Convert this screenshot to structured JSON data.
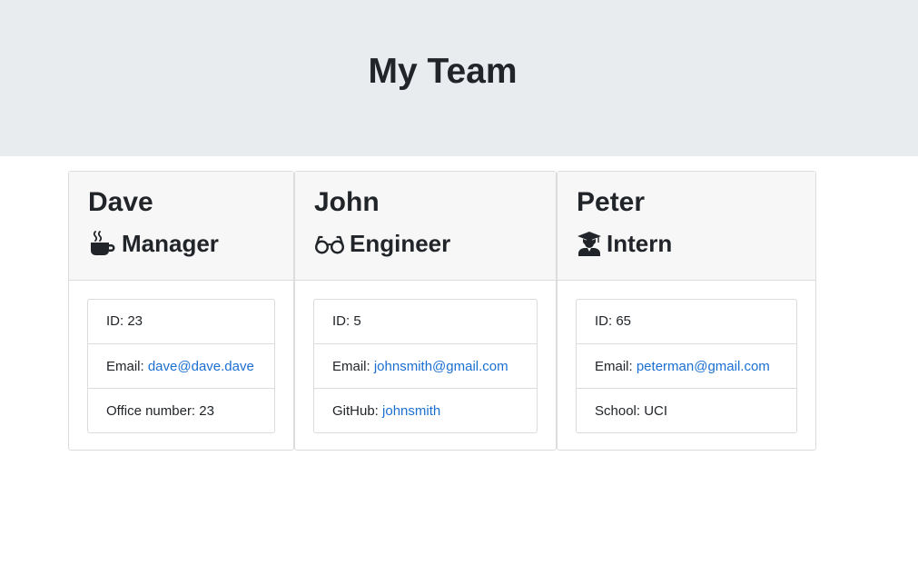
{
  "header": {
    "title": "My Team"
  },
  "cards": [
    {
      "name": "Dave",
      "role": "Manager",
      "icon": "coffee-mug-icon",
      "id_label": "ID: ",
      "id": "23",
      "email_label": "Email: ",
      "email": "dave@dave.dave",
      "extra_label": "Office number: ",
      "extra": "23"
    },
    {
      "name": "John",
      "role": "Engineer",
      "icon": "glasses-icon",
      "id_label": "ID: ",
      "id": "5",
      "email_label": "Email: ",
      "email": "johnsmith@gmail.com",
      "extra_label": "GitHub: ",
      "extra": "johnsmith"
    },
    {
      "name": "Peter",
      "role": "Intern",
      "icon": "graduate-icon",
      "id_label": "ID: ",
      "id": "65",
      "email_label": "Email: ",
      "email": "peterman@gmail.com",
      "extra_label": "School: ",
      "extra": "UCI"
    }
  ],
  "colors": {
    "header_bg": "#e9ecef",
    "card_header_bg": "#f7f7f7",
    "link": "#1b6fd1",
    "text": "#212529"
  }
}
